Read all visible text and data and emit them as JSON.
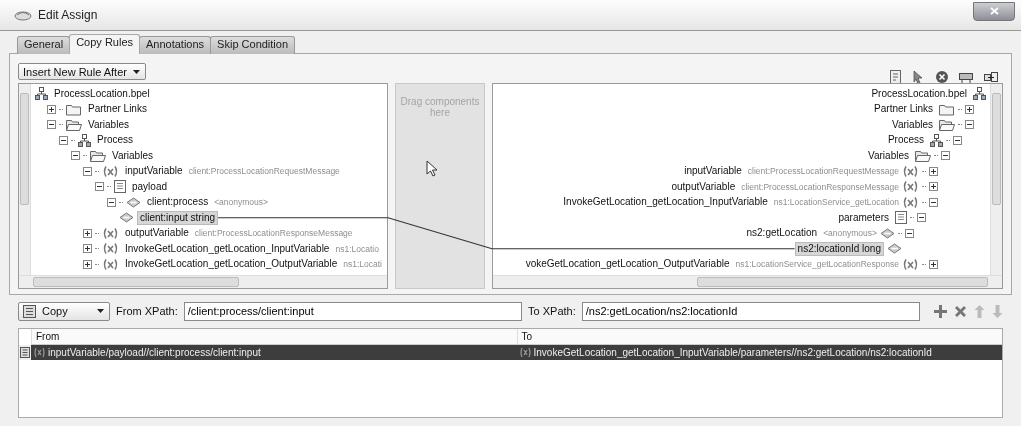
{
  "window": {
    "title": "Edit Assign"
  },
  "tabs": [
    {
      "label": "General",
      "selected": false
    },
    {
      "label": "Copy Rules",
      "selected": true
    },
    {
      "label": "Annotations",
      "selected": false
    },
    {
      "label": "Skip Condition",
      "selected": false
    }
  ],
  "insert_menu": {
    "value": "Insert New Rule After"
  },
  "source_tree": {
    "nodes": [
      {
        "label": "ProcessLocation.bpel",
        "kind": "process",
        "selected": false,
        "children": [
          {
            "label": "Partner Links",
            "kind": "folder",
            "expanded": false,
            "selected": false
          },
          {
            "label": "Variables",
            "kind": "folder",
            "expanded": true,
            "selected": false,
            "children": [
              {
                "label": "Process",
                "kind": "process",
                "expanded": true,
                "selected": false,
                "children": [
                  {
                    "label": "Variables",
                    "kind": "folder",
                    "expanded": true,
                    "selected": false,
                    "children": [
                      {
                        "label": "inputVariable",
                        "type": "client:ProcessLocationRequestMessage",
                        "kind": "variable",
                        "expanded": true,
                        "selected": false,
                        "children": [
                          {
                            "label": "payload",
                            "kind": "part",
                            "expanded": true,
                            "selected": false,
                            "children": [
                              {
                                "label": "client:process",
                                "type": "<anonymous>",
                                "kind": "element",
                                "expanded": true,
                                "selected": false,
                                "children": [
                                  {
                                    "label": "client:input string",
                                    "kind": "element",
                                    "selected": true
                                  }
                                ]
                              }
                            ]
                          }
                        ]
                      },
                      {
                        "label": "outputVariable",
                        "type": "client:ProcessLocationResponseMessage",
                        "kind": "variable",
                        "expanded": false,
                        "selected": false
                      },
                      {
                        "label": "InvokeGetLocation_getLocation_InputVariable",
                        "type": "ns1:Locatio",
                        "kind": "variable",
                        "expanded": false,
                        "selected": false
                      },
                      {
                        "label": "InvokeGetLocation_getLocation_OutputVariable",
                        "type": "ns1:Locati",
                        "kind": "variable",
                        "expanded": false,
                        "selected": false
                      }
                    ]
                  }
                ]
              }
            ]
          }
        ]
      }
    ]
  },
  "drop_zone": {
    "hint": "Drag components here"
  },
  "target_tree": {
    "nodes": [
      {
        "label": "ProcessLocation.bpel",
        "kind": "process",
        "selected": false,
        "children": [
          {
            "label": "Partner Links",
            "kind": "folder",
            "expanded": false,
            "selected": false
          },
          {
            "label": "Variables",
            "kind": "folder",
            "expanded": true,
            "selected": false,
            "children": [
              {
                "label": "Process",
                "kind": "process",
                "expanded": true,
                "selected": false,
                "children": [
                  {
                    "label": "Variables",
                    "kind": "folder",
                    "expanded": true,
                    "selected": false,
                    "children": [
                      {
                        "label": "inputVariable",
                        "type": "client:ProcessLocationRequestMessage",
                        "kind": "variable",
                        "expanded": false,
                        "selected": false
                      },
                      {
                        "label": "outputVariable",
                        "type": "client:ProcessLocationResponseMessage",
                        "kind": "variable",
                        "expanded": false,
                        "selected": false
                      },
                      {
                        "label": "InvokeGetLocation_getLocation_InputVariable",
                        "type": "ns1:LocationService_getLocation",
                        "kind": "variable",
                        "expanded": true,
                        "selected": false,
                        "children": [
                          {
                            "label": "parameters",
                            "kind": "part",
                            "expanded": true,
                            "selected": false,
                            "children": [
                              {
                                "label": "ns2:getLocation",
                                "type": "<anonymous>",
                                "kind": "element",
                                "expanded": true,
                                "selected": false,
                                "children": [
                                  {
                                    "label": "ns2:locationId long",
                                    "kind": "element",
                                    "selected": true
                                  }
                                ]
                              }
                            ]
                          }
                        ]
                      },
                      {
                        "label": "vokeGetLocation_getLocation_OutputVariable",
                        "type": "ns1:LocationService_getLocationResponse",
                        "kind": "variable",
                        "expanded": false,
                        "selected": false
                      }
                    ]
                  }
                ]
              }
            ]
          }
        ]
      }
    ]
  },
  "rule_bar": {
    "operation": "Copy",
    "from_label": "From XPath:",
    "from_value": "/client:process/client:input",
    "to_label": "To XPath:",
    "to_value": "/ns2:getLocation/ns2:locationId"
  },
  "rules_table": {
    "columns": [
      "From",
      "To"
    ],
    "rows": [
      {
        "cells": [
          "inputVariable/payload//client:process/client:input",
          "InvokeGetLocation_getLocation_InputVariable/parameters//ns2:getLocation/ns2:locationId"
        ],
        "selected": true
      }
    ]
  }
}
